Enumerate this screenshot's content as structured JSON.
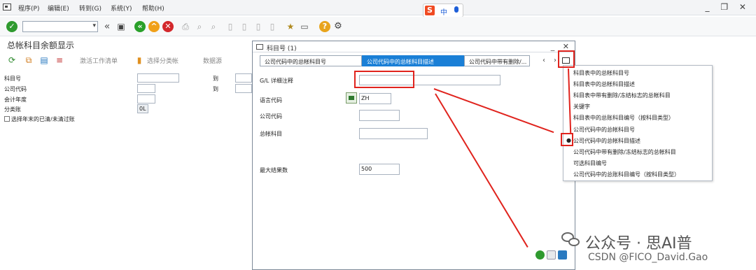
{
  "menu": {
    "items": [
      "程序(P)",
      "编辑(E)",
      "转到(G)",
      "系统(Y)",
      "帮助(H)"
    ]
  },
  "ime": {
    "badge": "S",
    "mode": "中"
  },
  "toolbar": {
    "command_value": ""
  },
  "page": {
    "title": "总帐科目余额显示",
    "app_buttons": [
      "激活工作清单",
      "选择分类帐",
      "数据源"
    ]
  },
  "selection": {
    "rows": [
      {
        "label": "科目号",
        "to_label": "到"
      },
      {
        "label": "公司代码",
        "to_label": "到"
      },
      {
        "label": "会计年度"
      },
      {
        "label": "分类账",
        "value": "0L"
      }
    ],
    "checkbox_label": "选择年末的已清/未清过账"
  },
  "dialog": {
    "title": "科目号 (1)",
    "tabs": [
      "公司代码中的总帐科目号",
      "公司代码中的总帐科目描述",
      "公司代码中带有删除/..."
    ],
    "fields": [
      {
        "label": "G/L 详细注释",
        "value": ""
      },
      {
        "label": "语言代码",
        "value": "ZH"
      },
      {
        "label": "公司代码",
        "value": ""
      },
      {
        "label": "总帐科目",
        "value": ""
      },
      {
        "label": "最大结果数",
        "value": "500"
      }
    ]
  },
  "popup": {
    "items": [
      "科目表中的总帐科目号",
      "科目表中的总帐科目描述",
      "科目表中带有删除/冻结标志的总帐科目",
      "关键字",
      "科目表中的总账科目编号（按科目类型）",
      "公司代码中的总帐科目号",
      "公司代码中的总帐科目描述",
      "公司代码中带有删除/冻结标志的总帐科目",
      "可选科目编号",
      "公司代码中的总账科目编号（按科目类型）"
    ],
    "selected_index": 6
  },
  "watermark": {
    "line1": "公众号 · 思AI普",
    "line2": "CSDN @FICO_David.Gao"
  },
  "colors": {
    "accent": "#1a7fd6",
    "highlight": "#e0231d"
  }
}
